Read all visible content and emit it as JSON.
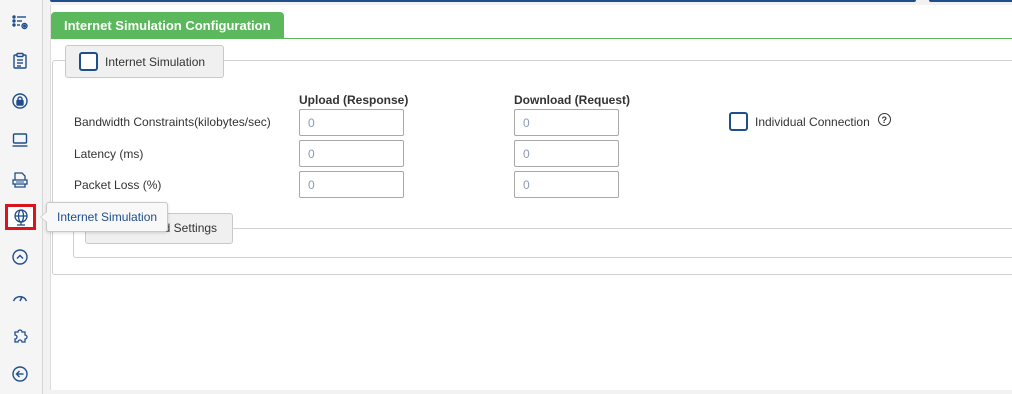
{
  "sidebar": {
    "items": [
      {
        "icon": "list-settings-icon"
      },
      {
        "icon": "clipboard-icon"
      },
      {
        "icon": "lock-icon"
      },
      {
        "icon": "monitor-icon"
      },
      {
        "icon": "document-icon"
      },
      {
        "icon": "globe-icon",
        "active": true
      },
      {
        "icon": "chevron-up-circle-icon"
      },
      {
        "icon": "speedometer-icon"
      },
      {
        "icon": "plugin-icon"
      },
      {
        "icon": "arrow-left-circle-icon"
      }
    ],
    "tooltip": "Internet Simulation"
  },
  "tab": {
    "title": "Internet Simulation Configuration"
  },
  "section": {
    "legend": "Internet Simulation",
    "enabled": false,
    "columns": {
      "upload": "Upload (Response)",
      "download": "Download (Request)"
    },
    "rows": [
      {
        "label": "Bandwidth Constraints(kilobytes/sec)",
        "upload": "0",
        "download": "0"
      },
      {
        "label": "Latency (ms)",
        "upload": "0",
        "download": "0"
      },
      {
        "label": "Packet Loss (%)",
        "upload": "0",
        "download": "0"
      }
    ],
    "individual_connection": {
      "label": "Individual Connection",
      "checked": false,
      "help": "?"
    }
  },
  "advanced": {
    "label": "Advanced Settings",
    "visible_label": "ed Settings"
  },
  "colors": {
    "accent": "#1f4e8c",
    "tab": "#5cb85c",
    "active_border": "#d9141c"
  }
}
